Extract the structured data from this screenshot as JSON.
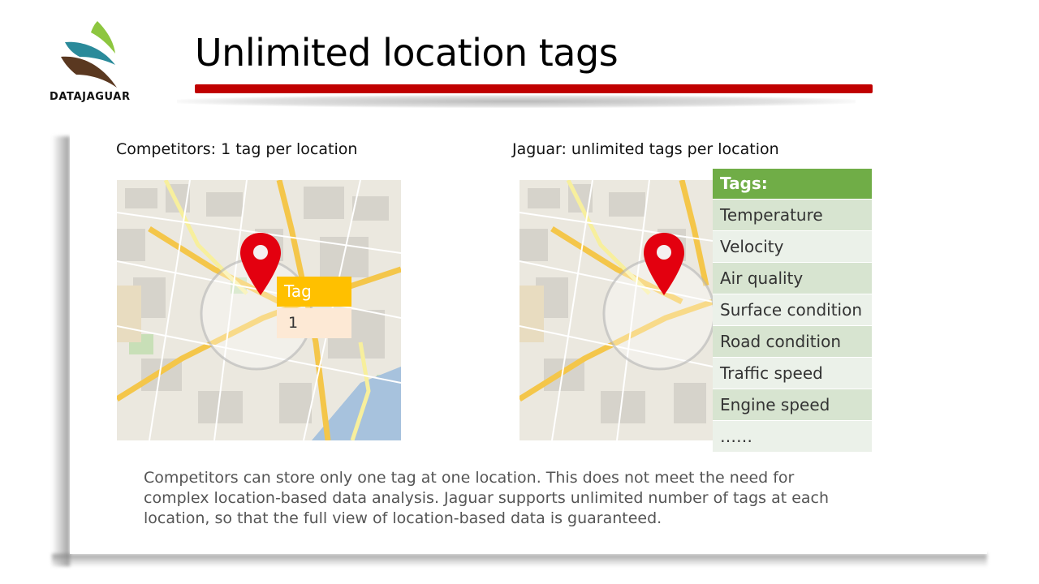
{
  "logo": {
    "text": "DATAJAGUAR"
  },
  "slide": {
    "title": "Unlimited location tags",
    "caption_left": "Competitors:  1 tag per location",
    "caption_right": "Jaguar: unlimited tags per location",
    "single_tag": {
      "header": "Tag",
      "value": "1"
    },
    "tags_table": {
      "header": "Tags:",
      "rows": [
        "Temperature",
        "Velocity",
        "Air quality",
        "Surface condition",
        "Road condition",
        "Traffic speed",
        "Engine speed",
        "……"
      ]
    },
    "description": "Competitors can store only one tag at one location. This does not meet the need for complex location-based data analysis. Jaguar supports unlimited number of tags at each location, so that the full view of location-based data is guaranteed."
  },
  "colors": {
    "title_bar": "#c00000",
    "tag_header": "#ffc000",
    "tag_value_bg": "#fde9d5",
    "table_header": "#70ad47",
    "pin": "#e3000f"
  },
  "icons": [
    "datajaguar-logo",
    "map-pin-icon",
    "map-pin-icon"
  ]
}
